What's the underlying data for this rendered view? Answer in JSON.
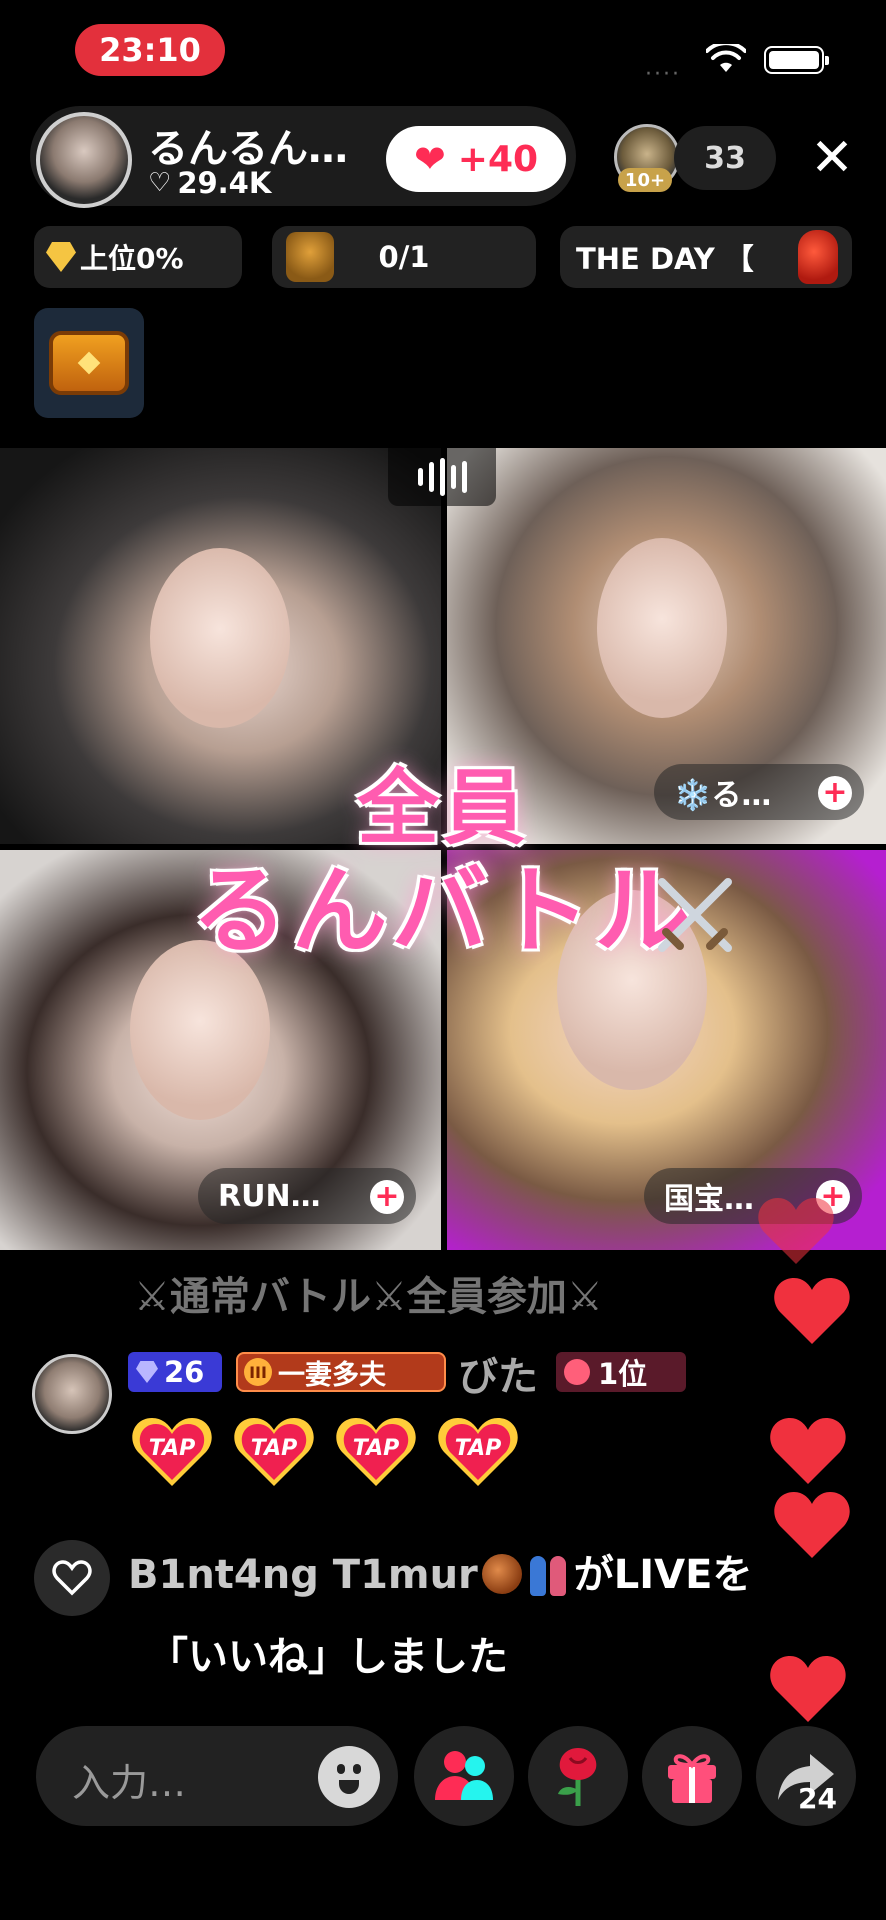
{
  "status_bar": {
    "time": "23:10",
    "signal_dots": "····"
  },
  "host": {
    "name": "るんるん…",
    "likes": "29.4K",
    "like_button_label": "+40"
  },
  "viewers": {
    "badge": "10+",
    "count": "33"
  },
  "chips": {
    "rank": "上位0%",
    "goal": "0/1",
    "event": "THE DAY 【"
  },
  "guests": [
    {
      "tag": "❄️る…"
    },
    {
      "tag": "RUN…"
    },
    {
      "tag": "国宝…"
    }
  ],
  "overlay": {
    "line1": "全員",
    "line2": "るんバトル"
  },
  "chat": {
    "faded_line": "⚔通常バトル⚔全員参加⚔",
    "message": {
      "gem_level": "26",
      "fan_badge_level": "III",
      "fan_badge": "一妻多夫",
      "user": "びた",
      "rank_badge": "1位",
      "taps": [
        "TAP",
        "TAP",
        "TAP",
        "TAP"
      ]
    },
    "like_notice_user": "B1nt4ng T1mur",
    "like_notice_suffix": "がLIVEを",
    "like_notice_line2": "「いいね」しました"
  },
  "bottom_bar": {
    "input_placeholder": "入力…",
    "share_count": "24"
  },
  "colors": {
    "accent": "#fe2c55",
    "time_pill": "#e3303c",
    "overlay_text": "#ff5cb0"
  }
}
